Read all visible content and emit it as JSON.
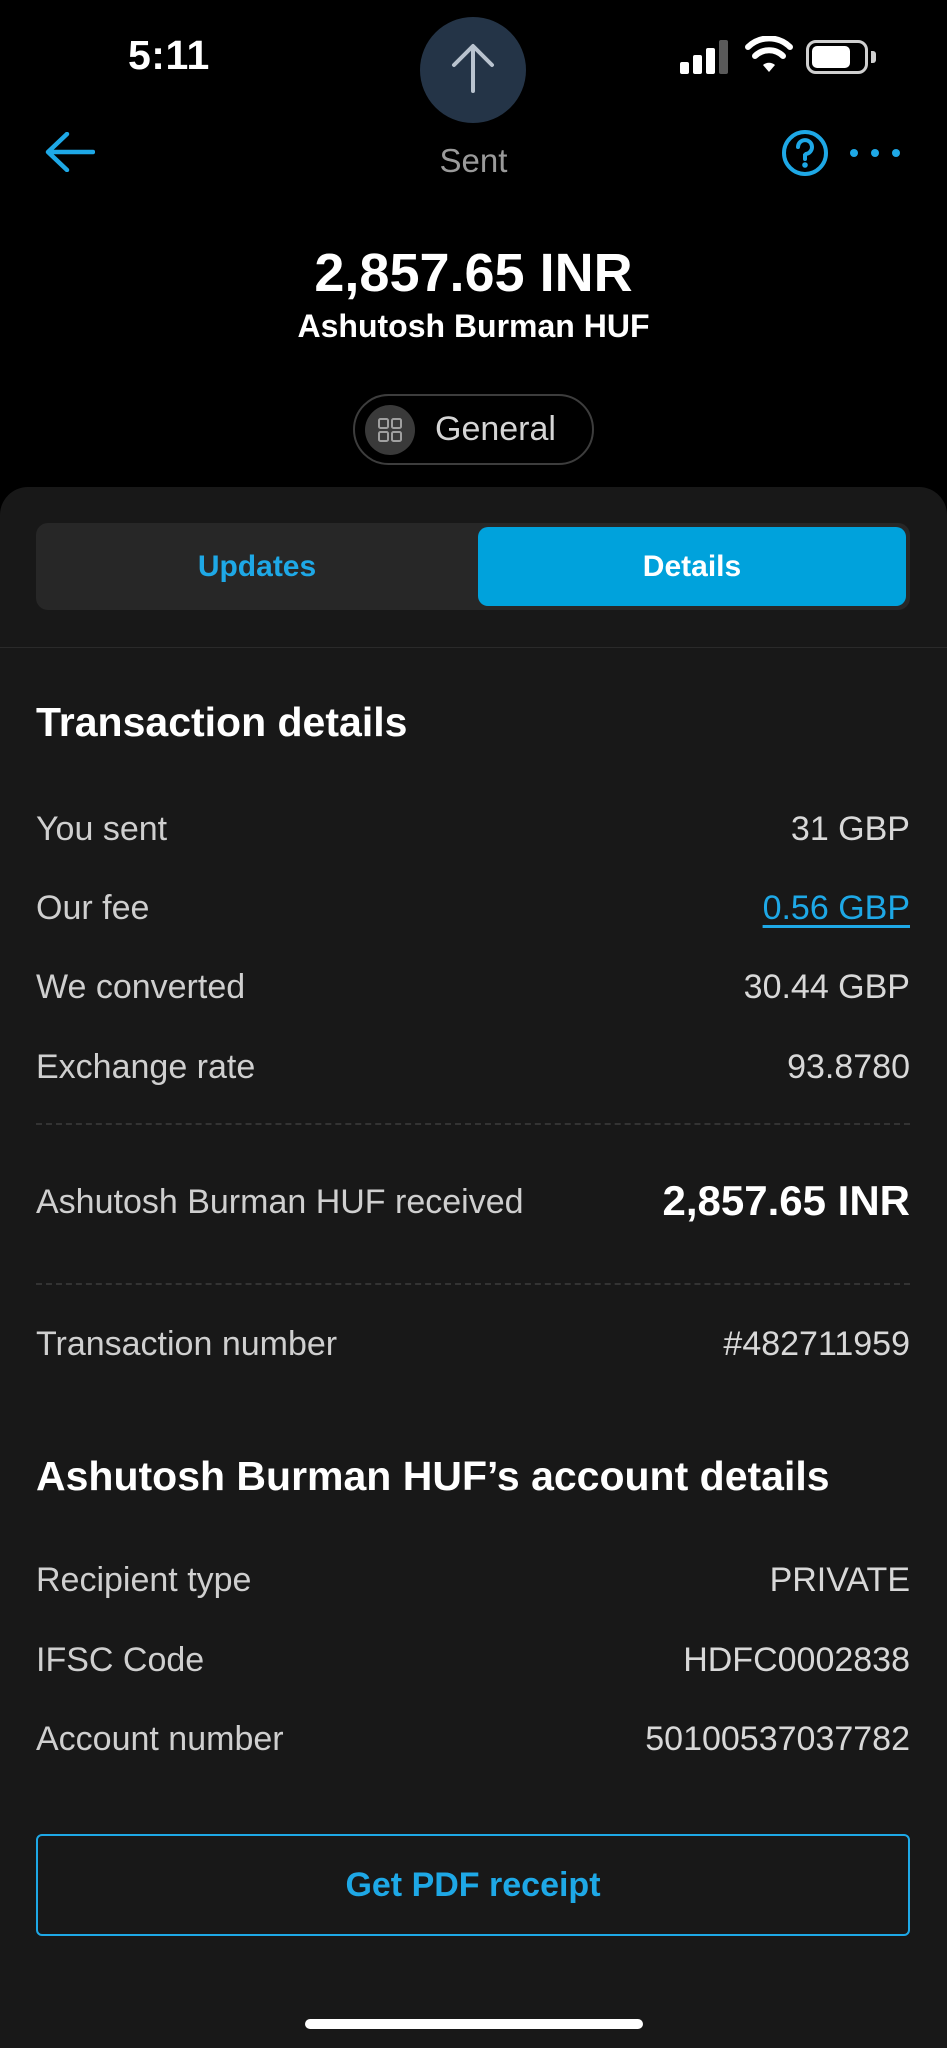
{
  "status_bar": {
    "time": "5:11"
  },
  "header": {
    "title": "Sent",
    "back_icon": "arrow-left-icon",
    "help_icon": "question-circle-icon",
    "more_icon": "more-horizontal-icon",
    "avatar_icon": "arrow-up-icon"
  },
  "summary": {
    "amount": "2,857.65 INR",
    "recipient": "Ashutosh Burman HUF",
    "category": "General",
    "category_icon": "grid-icon"
  },
  "tabs": {
    "updates": "Updates",
    "details": "Details",
    "selected": "Details"
  },
  "transaction_details": {
    "title": "Transaction details",
    "rows": [
      {
        "label": "You sent",
        "value": "31 GBP"
      },
      {
        "label": "Our fee",
        "value": "0.56 GBP"
      },
      {
        "label": "We converted",
        "value": "30.44 GBP"
      },
      {
        "label": "Exchange rate",
        "value": "93.8780"
      }
    ],
    "received": {
      "label": "Ashutosh Burman HUF received",
      "value": "2,857.65 INR"
    },
    "transaction_number": {
      "label": "Transaction number",
      "value": "#482711959"
    }
  },
  "account_details": {
    "title": "Ashutosh Burman HUF’s account details",
    "rows": [
      {
        "label": "Recipient type",
        "value": "PRIVATE"
      },
      {
        "label": "IFSC Code",
        "value": "HDFC0002838"
      },
      {
        "label": "Account number",
        "value": "50100537037782"
      }
    ]
  },
  "actions": {
    "pdf_receipt": "Get PDF receipt"
  },
  "colors": {
    "accent": "#1ea8e6",
    "selected_tab": "#00a2dc",
    "sheet_background": "#181818",
    "background": "#000000"
  }
}
